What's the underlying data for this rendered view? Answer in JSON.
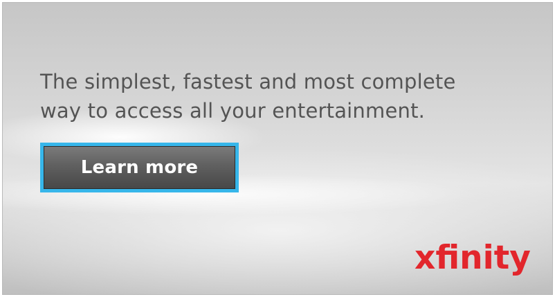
{
  "ad": {
    "headline_line1": "The simplest, fastest and most complete",
    "headline_line2": "way to access all your entertainment.",
    "cta_label": "Learn more",
    "brand": "xfinity"
  },
  "colors": {
    "text": "#545454",
    "button_border": "#37b6ea",
    "button_fill": "#5e5e5e",
    "brand_red": "#e2262c"
  }
}
